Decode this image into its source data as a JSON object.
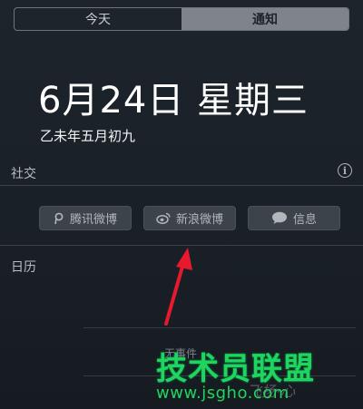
{
  "tabs": {
    "today": "今天",
    "notifications": "通知"
  },
  "date": {
    "main": "6月24日 星期三",
    "lunar": "乙未年五月初九"
  },
  "social": {
    "title": "社交",
    "buttons": [
      {
        "label": "腾讯微博",
        "icon": "tencent-weibo-icon"
      },
      {
        "label": "新浪微博",
        "icon": "sina-weibo-icon"
      },
      {
        "label": "信息",
        "icon": "message-bubble-icon"
      }
    ]
  },
  "calendar": {
    "title": "日历",
    "events_text": "无事件"
  },
  "watermark": {
    "brand": "技术员联盟",
    "url": "www.jsgho.com",
    "faint": "飞扬·心"
  },
  "colors": {
    "accent_arrow": "#e8192c",
    "watermark_green": "#1fd55e"
  }
}
